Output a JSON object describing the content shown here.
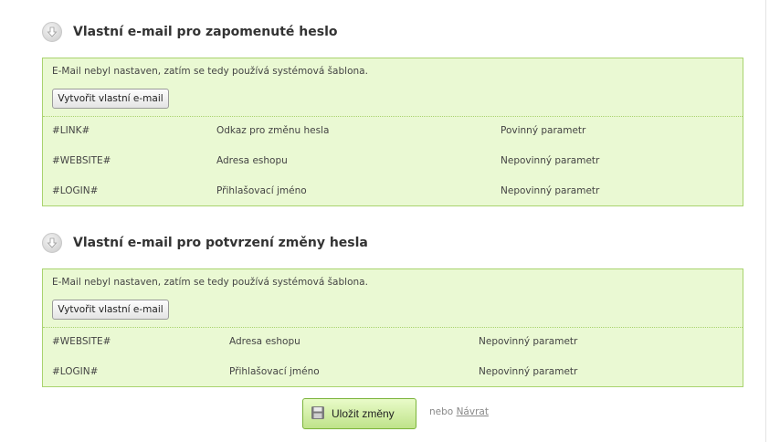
{
  "sections": [
    {
      "title": "Vlastní e-mail pro zapomenuté heslo",
      "notice": "E-Mail nebyl nastaven, zatím se tedy používá systémová šablona.",
      "create_button": "Vytvořit vlastní e-mail",
      "params": [
        {
          "name": "#LINK#",
          "desc": "Odkaz pro změnu hesla",
          "req": "Povinný parametr"
        },
        {
          "name": "#WEBSITE#",
          "desc": "Adresa eshopu",
          "req": "Nepovinný parametr"
        },
        {
          "name": "#LOGIN#",
          "desc": "Přihlašovací jméno",
          "req": "Nepovinný parametr"
        }
      ]
    },
    {
      "title": "Vlastní e-mail pro potvrzení změny hesla",
      "notice": "E-Mail nebyl nastaven, zatím se tedy používá systémová šablona.",
      "create_button": "Vytvořit vlastní e-mail",
      "params": [
        {
          "name": "#WEBSITE#",
          "desc": "Adresa eshopu",
          "req": "Nepovinný parametr"
        },
        {
          "name": "#LOGIN#",
          "desc": "Přihlašovací jméno",
          "req": "Nepovinný parametr"
        }
      ]
    }
  ],
  "footer": {
    "save_label": "Uložit změny",
    "or_text": "nebo",
    "back_link": "Návrat"
  },
  "icons": {
    "section": "chevron-down-circle-icon",
    "save": "floppy-disk-icon"
  },
  "colors": {
    "panel_bg": "#eaf9d3",
    "panel_border": "#a9d36e",
    "save_button": "#bfe38a"
  }
}
